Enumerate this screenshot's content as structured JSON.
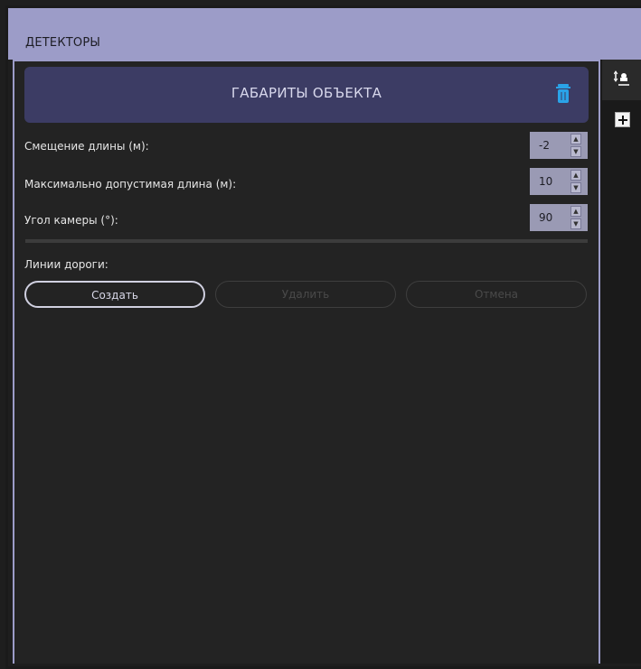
{
  "window": {
    "title": "ДЕТЕКТОРЫ"
  },
  "section": {
    "title": "ГАБАРИТЫ ОБЪЕКТА"
  },
  "fields": [
    {
      "label": "Смещение длины (м):",
      "value": "-2"
    },
    {
      "label": "Максимально допустимая длина (м):",
      "value": "10"
    },
    {
      "label": "Угол камеры (°):",
      "value": "90"
    }
  ],
  "road_lines": {
    "label": "Линии дороги:",
    "buttons": {
      "create": "Создать",
      "delete": "Удалить",
      "cancel": "Отмена"
    }
  },
  "icons": {
    "trash": "trash-icon",
    "tab": "object-size-icon",
    "add": "plus-icon"
  },
  "colors": {
    "header": "#9c9cc8",
    "section": "#3c3c64",
    "trash": "#2aa3e8"
  }
}
